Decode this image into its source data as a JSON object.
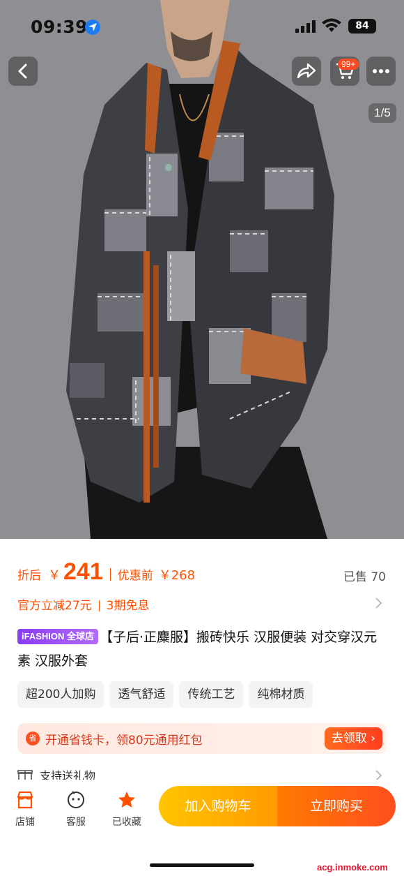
{
  "status_bar": {
    "time": "09:39",
    "battery": "84"
  },
  "gallery": {
    "page_indicator": "1/5",
    "cart_badge": "99+"
  },
  "price": {
    "prefix": "折后",
    "currency": "￥",
    "amount": "241",
    "original_label": "优惠前",
    "original_price": "￥268",
    "sold": "已售 70"
  },
  "promo": {
    "discount": "官方立减27元",
    "installment": "3期免息"
  },
  "product": {
    "brand_tag": "iFASHION 全球店",
    "title": "【子后·正麋服】搬砖快乐 汉服便装 对交穿汉元素 汉服外套"
  },
  "tags": [
    "超200人加购",
    "透气舒适",
    "传统工艺",
    "纯棉材质"
  ],
  "coupon": {
    "icon": "省",
    "text": "开通省钱卡，领80元通用红包",
    "button": "去领取 ›"
  },
  "gift": {
    "text": "支持送礼物"
  },
  "bottom_bar": {
    "shop": "店铺",
    "service": "客服",
    "favorited": "已收藏",
    "add_to_cart": "加入购物车",
    "buy_now": "立即购买"
  },
  "watermark": "acg.inmoke.com",
  "colors": {
    "accent": "#ff5000",
    "cart_button": "#ffb300",
    "buy_button": "#ff5a1f",
    "brand_tag": "#9b4dff"
  }
}
